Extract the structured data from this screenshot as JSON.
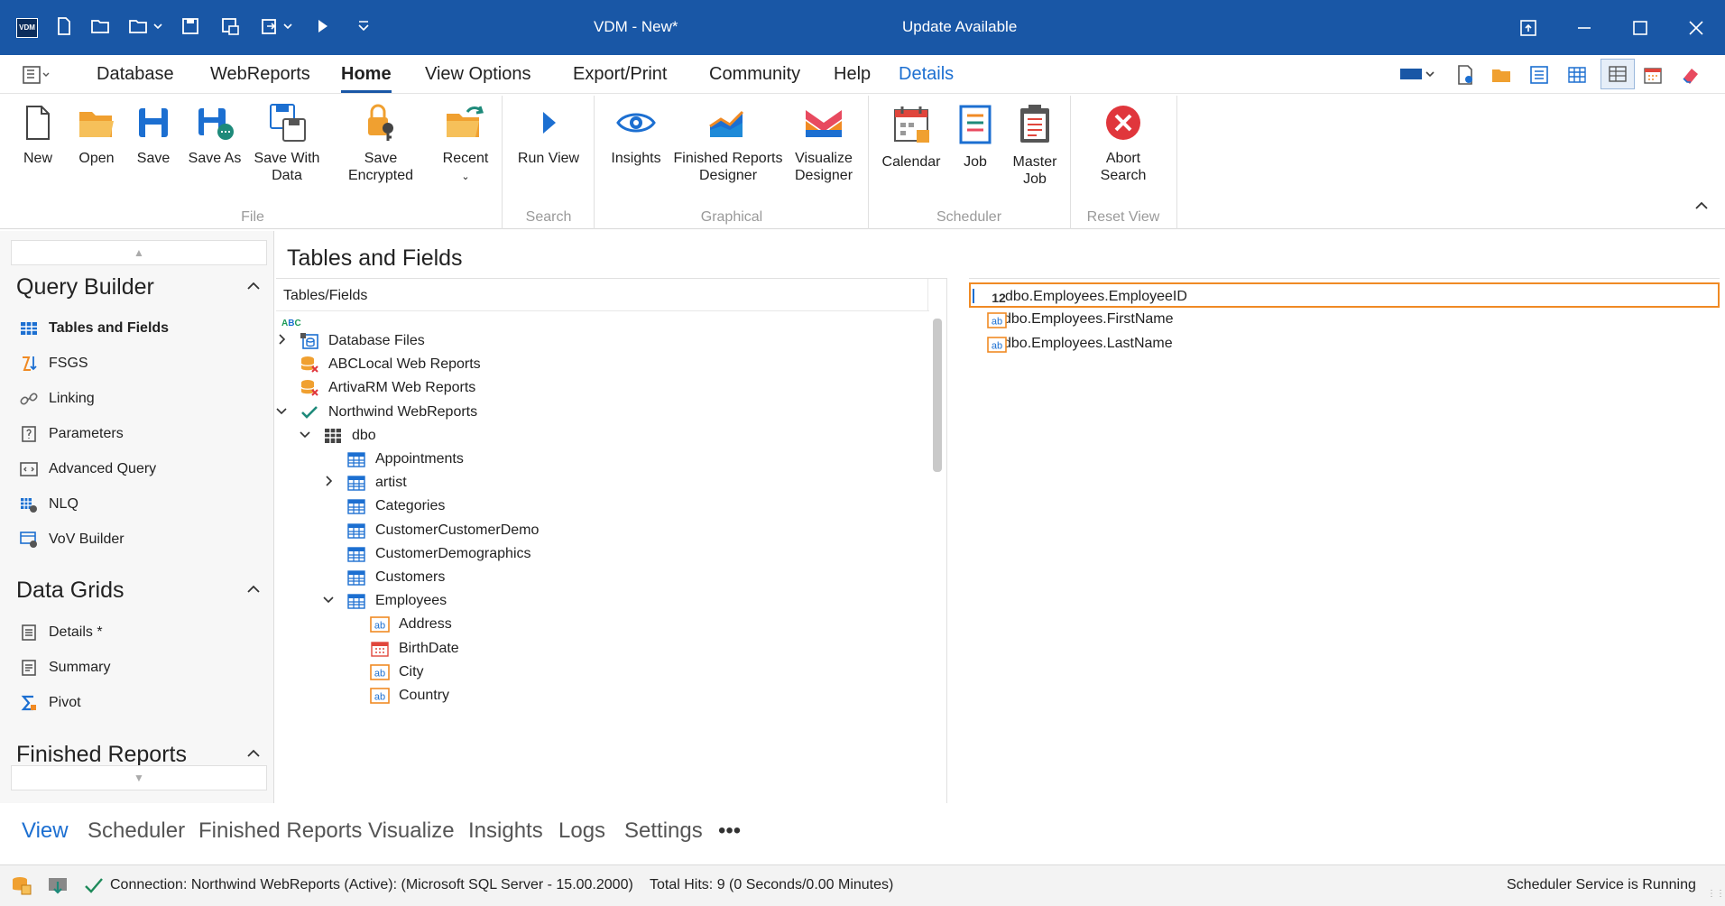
{
  "app": {
    "title": "VDM - New*",
    "update": "Update Available",
    "logo": "VDM"
  },
  "menu": {
    "items": [
      "Database",
      "WebReports",
      "Home",
      "View Options",
      "Export/Print",
      "Community",
      "Help",
      "Details"
    ],
    "active": "Home"
  },
  "ribbon": {
    "file": {
      "new": "New",
      "open": "Open",
      "save": "Save",
      "save_as": "Save As",
      "save_with_data_1": "Save With",
      "save_with_data_2": "Data",
      "save_encrypted": "Save Encrypted",
      "recent": "Recent",
      "group": "File"
    },
    "search": {
      "run_view": "Run View",
      "group": "Search"
    },
    "graphical": {
      "insights": "Insights",
      "frd_1": "Finished Reports",
      "frd_2": "Designer",
      "vis_1": "Visualize",
      "vis_2": "Designer",
      "group": "Graphical"
    },
    "scheduler": {
      "calendar": "Calendar",
      "job": "Job",
      "master_1": "Master",
      "master_2": "Job",
      "group": "Scheduler"
    },
    "reset": {
      "abort_1": "Abort",
      "abort_2": "Search",
      "group": "Reset View"
    }
  },
  "sidebar": {
    "query_builder": {
      "title": "Query Builder",
      "items": [
        "Tables and Fields",
        "FSGS",
        "Linking",
        "Parameters",
        "Advanced Query",
        "NLQ",
        "VoV Builder"
      ]
    },
    "data_grids": {
      "title": "Data Grids",
      "items": [
        "Details *",
        "Summary",
        "Pivot"
      ]
    },
    "finished_reports": {
      "title": "Finished Reports"
    }
  },
  "main": {
    "title": "Tables and Fields",
    "tree_header": "Tables/Fields",
    "tree": [
      {
        "label": "Database Files",
        "icon": "database-files-icon",
        "exp": ">",
        "level": 0
      },
      {
        "label": "ABCLocal Web Reports",
        "icon": "db-error-icon",
        "exp": "",
        "level": 0
      },
      {
        "label": "ArtivaRM Web Reports",
        "icon": "db-error-icon",
        "exp": "",
        "level": 0
      },
      {
        "label": "Northwind WebReports",
        "icon": "check-icon",
        "exp": "v",
        "level": 0
      },
      {
        "label": "dbo",
        "icon": "schema-grid-icon",
        "exp": "v",
        "level": 1
      },
      {
        "label": "Appointments",
        "icon": "table-icon",
        "exp": "",
        "level": 2
      },
      {
        "label": "artist",
        "icon": "table-icon",
        "exp": ">",
        "level": 2
      },
      {
        "label": "Categories",
        "icon": "table-icon",
        "exp": "",
        "level": 2
      },
      {
        "label": "CustomerCustomerDemo",
        "icon": "table-icon",
        "exp": "",
        "level": 2
      },
      {
        "label": "CustomerDemographics",
        "icon": "table-icon",
        "exp": "",
        "level": 2
      },
      {
        "label": "Customers",
        "icon": "table-icon",
        "exp": "",
        "level": 2
      },
      {
        "label": "Employees",
        "icon": "table-icon",
        "exp": "v",
        "level": 2
      },
      {
        "label": "Address",
        "icon": "text-field-icon",
        "exp": "",
        "level": 3
      },
      {
        "label": "BirthDate",
        "icon": "date-field-icon",
        "exp": "",
        "level": 3
      },
      {
        "label": "City",
        "icon": "text-field-icon",
        "exp": "",
        "level": 3
      },
      {
        "label": "Country",
        "icon": "text-field-icon",
        "exp": "",
        "level": 3
      }
    ],
    "selected_fields": [
      {
        "label": "dbo.Employees.EmployeeID",
        "icon": "number-field-icon",
        "prefix": "12"
      },
      {
        "label": "dbo.Employees.FirstName",
        "icon": "text-field-icon",
        "prefix": "ab"
      },
      {
        "label": "dbo.Employees.LastName",
        "icon": "text-field-icon",
        "prefix": "ab"
      }
    ]
  },
  "bottom_tabs": [
    "View",
    "Scheduler",
    "Finished Reports",
    "Visualize",
    "Insights",
    "Logs",
    "Settings",
    "•••"
  ],
  "status": {
    "connection": "Connection: Northwind WebReports (Active): (Microsoft SQL Server - 15.00.2000)",
    "hits": "Total Hits: 9 (0 Seconds/0.00 Minutes)",
    "scheduler": "Scheduler Service is Running"
  },
  "colors": {
    "titlebar": "#1957a6",
    "accent": "#1c6fd1",
    "highlight": "#f08a24"
  }
}
